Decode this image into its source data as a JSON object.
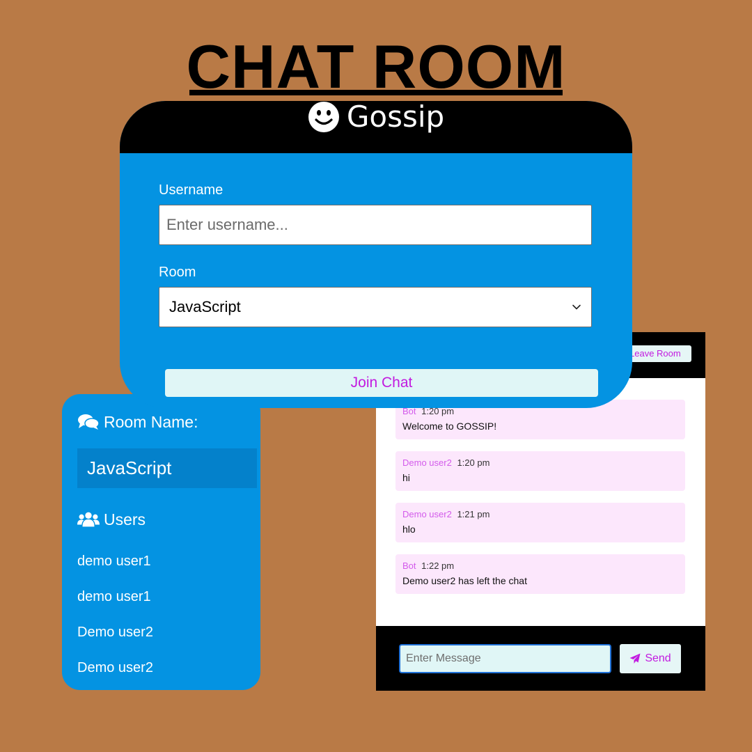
{
  "page": {
    "title": "CHAT ROOM"
  },
  "join": {
    "brand_name": "Gossip",
    "brand_icon": "smiley-icon",
    "username_label": "Username",
    "username_placeholder": "Enter username...",
    "username_value": "",
    "room_label": "Room",
    "room_selected": "JavaScript",
    "join_button": "Join Chat"
  },
  "sidebar": {
    "room_heading": "Room Name:",
    "room_heading_icon": "comments-icon",
    "room_name": "JavaScript",
    "users_heading": "Users",
    "users_heading_icon": "users-icon",
    "users": [
      "demo user1",
      "demo user1",
      "Demo user2",
      "Demo user2"
    ]
  },
  "chat": {
    "leave_button": "Leave Room",
    "messages": [
      {
        "sender": "Bot",
        "time": "1:20 pm",
        "text": "Welcome to GOSSIP!"
      },
      {
        "sender": "Demo user2",
        "time": "1:20 pm",
        "text": "hi"
      },
      {
        "sender": "Demo user2",
        "time": "1:21 pm",
        "text": "hlo"
      },
      {
        "sender": "Bot",
        "time": "1:22 pm",
        "text": "Demo user2 has left the chat"
      }
    ],
    "message_placeholder": "Enter Message",
    "send_button": "Send",
    "send_icon": "paper-plane-icon"
  },
  "colors": {
    "background": "#B97A46",
    "panel_blue": "#0493E2",
    "header_black": "#000000",
    "accent_magenta": "#C21BE0",
    "message_bg": "#FCE7FC",
    "button_bg": "#E0F6F6"
  }
}
